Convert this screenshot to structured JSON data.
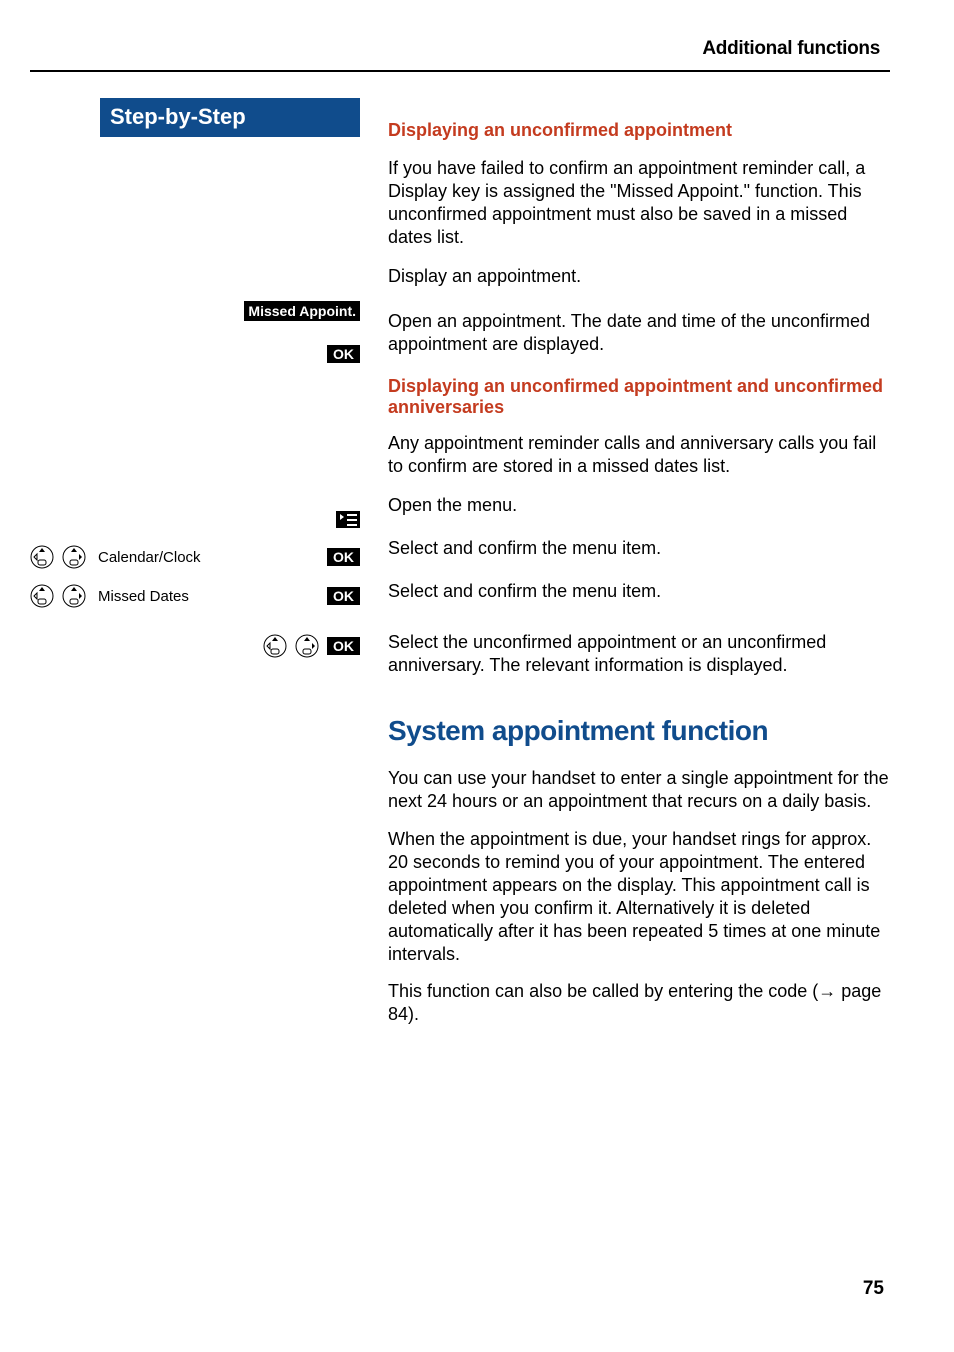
{
  "header": {
    "section_title": "Additional functions"
  },
  "left": {
    "banner": "Step-by-Step",
    "missed_appoint_pill": "Missed Appoint.",
    "ok_pill": "OK",
    "calendar_clock_label": "Calendar/Clock",
    "missed_dates_label": "Missed Dates"
  },
  "right": {
    "h1": "Displaying an unconfirmed appointment",
    "p1": "If you have failed to confirm an appointment reminder call, a Display key is assigned the \"Missed Appoint.\" function. This unconfirmed appointment must also be saved in a missed dates list.",
    "p2": "Display an appointment.",
    "p3": "Open an appointment. The date and time of the unconfirmed appointment are displayed.",
    "h2": "Displaying an unconfirmed appointment and unconfirmed anniversaries",
    "p4": "Any appointment reminder calls and anniversary calls you fail to confirm are stored in a missed dates list.",
    "p5": "Open the menu.",
    "p6": "Select and confirm the menu item.",
    "p7": "Select and confirm the menu item.",
    "p8": "Select the unconfirmed appointment or an unconfirmed anniversary. The relevant information is displayed.",
    "h_blue": "System appointment function",
    "p9": "You can use your handset to enter a single appointment for the next 24 hours or an appointment that recurs on a daily basis.",
    "p10": "When the appointment is due, your handset rings for approx. 20 seconds to remind you of your appointment. The entered appointment appears on the display. This appointment call is deleted when you confirm it. Alternatively it is deleted automatically after it has been repeated 5 times at one minute intervals.",
    "p11a": "This function can also be called by entering the code (",
    "p11b": " page 84)."
  },
  "page_number": "75"
}
